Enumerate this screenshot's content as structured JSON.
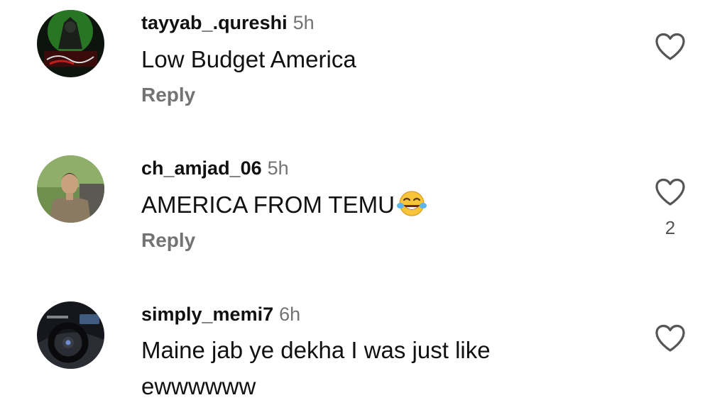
{
  "comments": [
    {
      "username": "tayyab_.qureshi",
      "time": "5h",
      "text": "Low Budget America",
      "reply_label": "Reply",
      "like_count": ""
    },
    {
      "username": "ch_amjad_06",
      "time": "5h",
      "text": "AMERICA FROM TEMU",
      "emoji": "face-with-tears-of-joy",
      "reply_label": "Reply",
      "like_count": "2"
    },
    {
      "username": "simply_memi7",
      "time": "6h",
      "text_line1": "Maine jab ye dekha I was just like",
      "text_line2": "ewwwwww",
      "reply_label": "",
      "like_count": ""
    }
  ],
  "icons": {
    "like": "heart-outline-icon"
  },
  "colors": {
    "text": "#111111",
    "secondary": "#737373"
  }
}
